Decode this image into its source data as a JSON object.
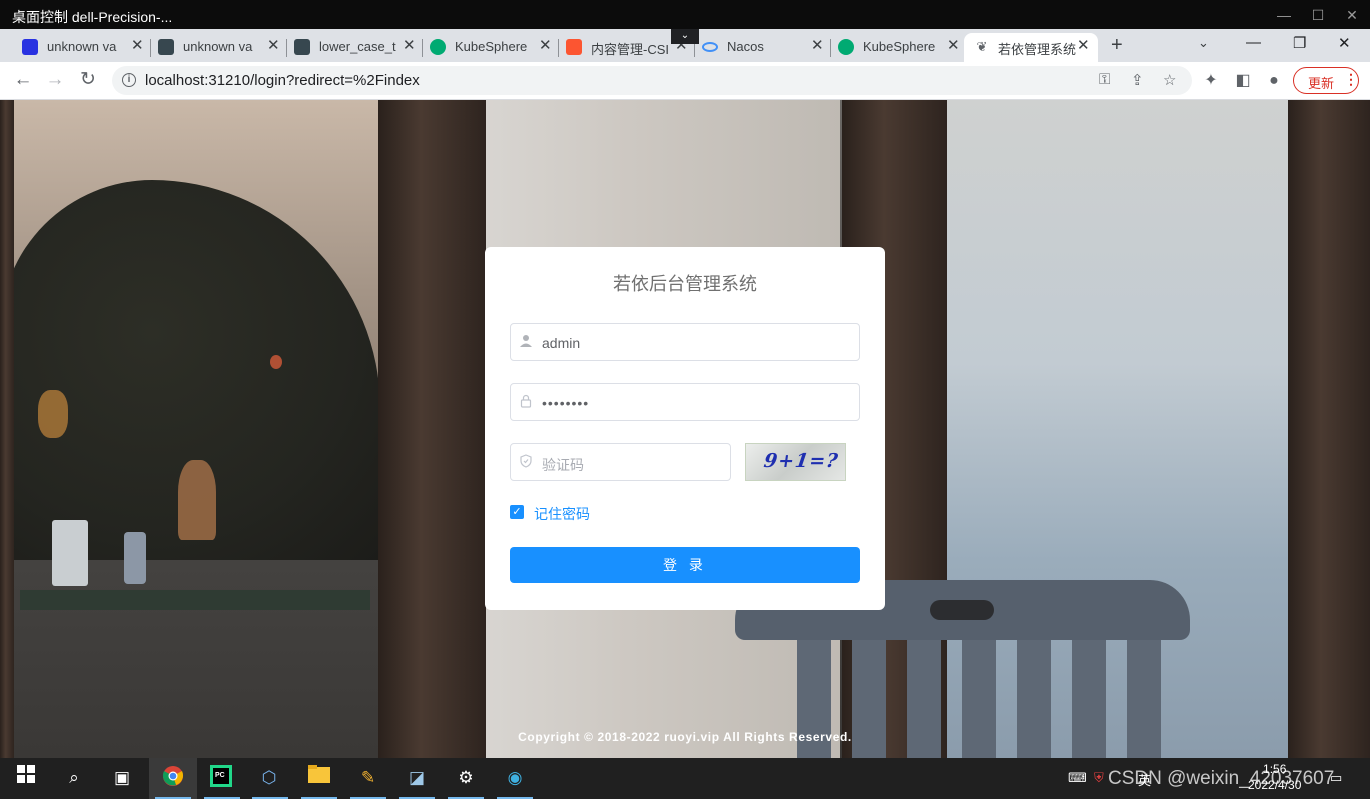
{
  "remote_desktop": {
    "title": "桌面控制 dell-Precision-..."
  },
  "browser": {
    "tabs": [
      {
        "label": "unknown va",
        "favicon": "baidu-paw-icon",
        "color": "#2932e1"
      },
      {
        "label": "unknown va",
        "favicon": "avatar-icon",
        "color": "#37474f"
      },
      {
        "label": "lower_case_t",
        "favicon": "avatar-icon",
        "color": "#37474f"
      },
      {
        "label": "KubeSphere",
        "favicon": "kubesphere-icon",
        "color": "#00aa72"
      },
      {
        "label": "内容管理-CSI",
        "favicon": "csdn-icon",
        "color": "#fc5531"
      },
      {
        "label": "Nacos",
        "favicon": "nacos-icon",
        "color": "#4190f7"
      },
      {
        "label": "KubeSphere",
        "favicon": "kubesphere-icon",
        "color": "#00aa72"
      },
      {
        "label": "若依管理系统",
        "favicon": "ruoyi-leaf-icon",
        "color": "#5f6368",
        "active": true
      }
    ],
    "url": "localhost:31210/login?redirect=%2Findex",
    "update_label": "更新"
  },
  "login": {
    "title": "若依后台管理系统",
    "username_value": "admin",
    "password_value": "••••••••",
    "captcha_placeholder": "验证码",
    "captcha_image_text": "9+1=?",
    "remember_label": "记住密码",
    "remember_checked": true,
    "submit_label": "登 录",
    "accent_color": "#1890ff"
  },
  "footer": {
    "copyright": "Copyright © 2018-2022 ruoyi.vip All Rights Reserved."
  },
  "taskbar": {
    "time": "1:56",
    "date": "2022/4/30",
    "tray_lang": "英"
  },
  "watermark": "CSDN @weixin_42037607"
}
